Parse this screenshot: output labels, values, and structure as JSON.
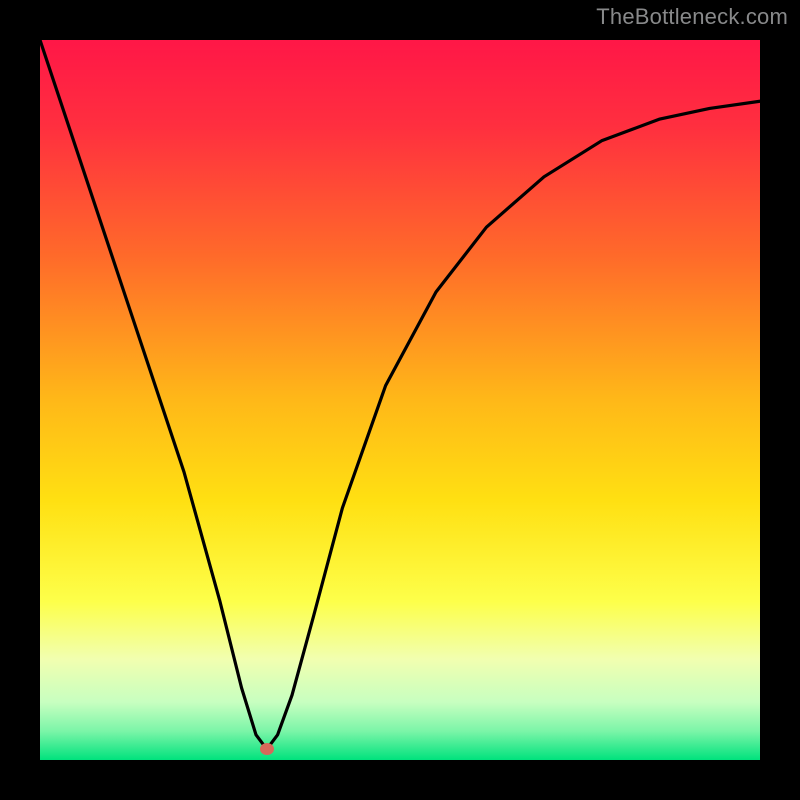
{
  "watermark": {
    "text": "TheBottleneck.com"
  },
  "colors": {
    "top": "#ff1747",
    "mid_upper": "#ff6a2a",
    "mid": "#ffd912",
    "lower_mid": "#f6ff70",
    "low": "#9dffb0",
    "bottom": "#00e27d",
    "curve": "#000000",
    "marker": "#d6695a",
    "background": "#000000"
  },
  "marker": {
    "x_frac": 0.315,
    "y_frac": 0.985
  },
  "chart_data": {
    "type": "line",
    "title": "",
    "xlabel": "",
    "ylabel": "",
    "xlim": [
      0,
      1
    ],
    "ylim": [
      0,
      1
    ],
    "notes": "Axes are unlabeled; values are normalized fractions of the plot area. y=1 is top edge, y=0 is bottom edge.",
    "series": [
      {
        "name": "bottleneck-curve",
        "x": [
          0.0,
          0.05,
          0.1,
          0.15,
          0.2,
          0.25,
          0.28,
          0.3,
          0.315,
          0.33,
          0.35,
          0.38,
          0.42,
          0.48,
          0.55,
          0.62,
          0.7,
          0.78,
          0.86,
          0.93,
          1.0
        ],
        "y": [
          1.0,
          0.85,
          0.7,
          0.55,
          0.4,
          0.22,
          0.1,
          0.035,
          0.015,
          0.035,
          0.09,
          0.2,
          0.35,
          0.52,
          0.65,
          0.74,
          0.81,
          0.86,
          0.89,
          0.905,
          0.915
        ]
      }
    ],
    "annotations": [
      {
        "type": "point",
        "x": 0.315,
        "y": 0.015,
        "label": "minimum-marker"
      }
    ]
  }
}
